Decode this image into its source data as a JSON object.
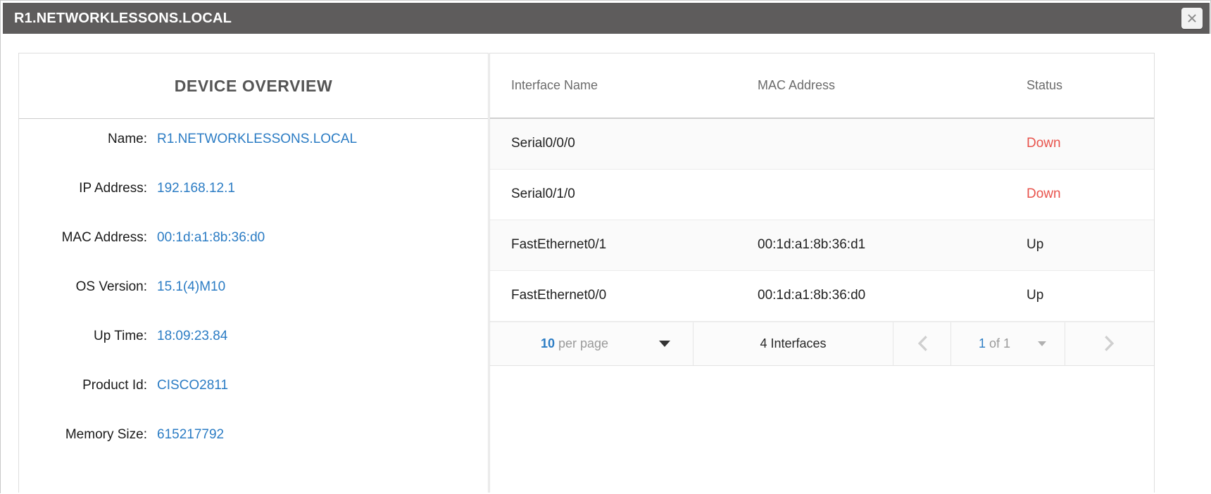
{
  "window": {
    "title": "R1.NETWORKLESSONS.LOCAL",
    "close_icon": "close-icon"
  },
  "device_overview": {
    "heading": "DEVICE OVERVIEW",
    "fields": [
      {
        "label": "Name:",
        "value": "R1.NETWORKLESSONS.LOCAL"
      },
      {
        "label": "IP Address:",
        "value": "192.168.12.1"
      },
      {
        "label": "MAC Address:",
        "value": "00:1d:a1:8b:36:d0"
      },
      {
        "label": "OS Version:",
        "value": "15.1(4)M10"
      },
      {
        "label": "Up Time:",
        "value": "18:09:23.84"
      },
      {
        "label": "Product Id:",
        "value": "CISCO2811"
      },
      {
        "label": "Memory Size:",
        "value": "615217792"
      }
    ]
  },
  "interfaces_table": {
    "columns": [
      "Interface Name",
      "MAC Address",
      "Status"
    ],
    "rows": [
      {
        "name": "Serial0/0/0",
        "mac": "",
        "status": "Down"
      },
      {
        "name": "Serial0/1/0",
        "mac": "",
        "status": "Down"
      },
      {
        "name": "FastEthernet0/1",
        "mac": "00:1d:a1:8b:36:d1",
        "status": "Up"
      },
      {
        "name": "FastEthernet0/0",
        "mac": "00:1d:a1:8b:36:d0",
        "status": "Up"
      }
    ],
    "pagination": {
      "per_page_value": "10",
      "per_page_label": "per page",
      "total_label": "4 Interfaces",
      "page_current": "1",
      "page_of": "of 1",
      "prev_icon": "chevron-left-icon",
      "next_icon": "chevron-right-icon",
      "per_page_caret_icon": "caret-down-icon",
      "page_caret_icon": "caret-down-icon"
    }
  },
  "colors": {
    "titlebar_bg": "#5e5c5c",
    "link_blue": "#2b7cc4",
    "status_down_red": "#e8534c",
    "heading_gray": "#555555",
    "row_stripe": "#fafafa"
  }
}
